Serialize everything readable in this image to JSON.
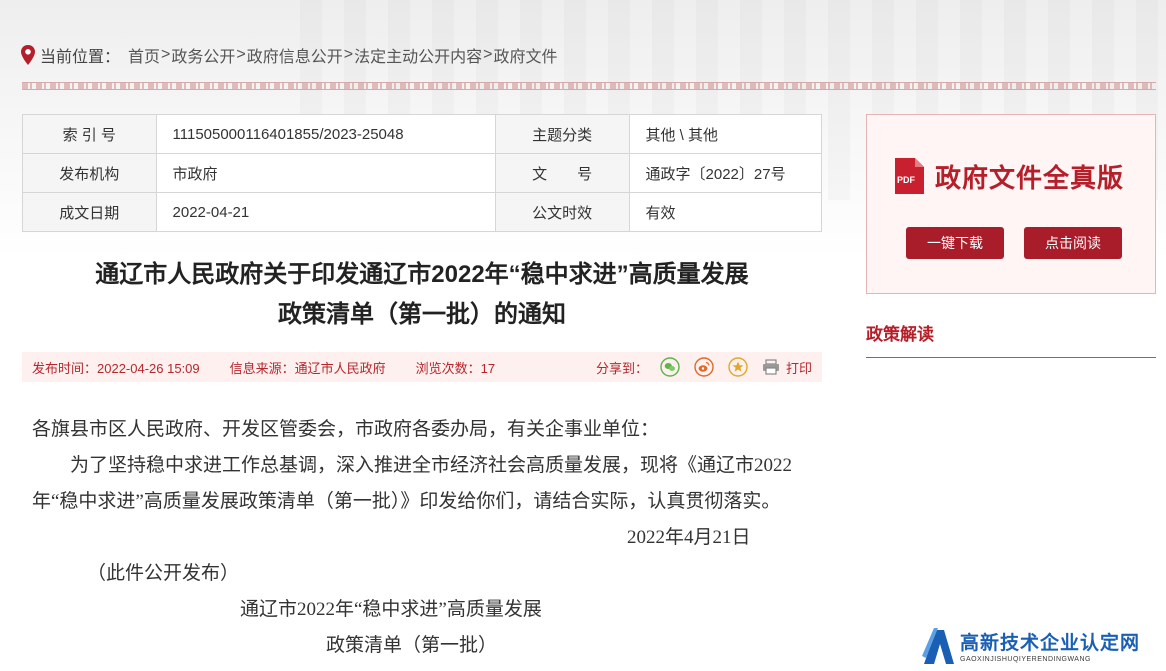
{
  "breadcrumb": {
    "label": "当前位置：",
    "items": [
      "首页",
      "政务公开",
      "政府信息公开",
      "法定主动公开内容",
      "政府文件"
    ],
    "separator": ">"
  },
  "meta": {
    "index_label": "索 引 号",
    "index_value": "111505000116401855/2023-25048",
    "topic_label": "主题分类",
    "topic_value": "其他 \\ 其他",
    "org_label": "发布机构",
    "org_value": "市政府",
    "docno_label": "文　　号",
    "docno_value": "通政字〔2022〕27号",
    "date_label": "成文日期",
    "date_value": "2022-04-21",
    "validity_label": "公文时效",
    "validity_value": "有效"
  },
  "title": {
    "line1": "通辽市人民政府关于印发通辽市2022年“稳中求进”高质量发展",
    "line2": "政策清单（第一批）的通知"
  },
  "infobar": {
    "publish_time": "发布时间：2022-04-26 15:09",
    "source": "信息来源：通辽市人民政府",
    "views": "浏览次数：17",
    "share_label": "分享到：",
    "print_label": "打印"
  },
  "content": {
    "salutation": "各旗县市区人民政府、开发区管委会，市政府各委办局，有关企事业单位：",
    "body": "为了坚持稳中求进工作总基调，深入推进全市经济社会高质量发展，现将《通辽市2022年“稳中求进”高质量发展政策清单（第一批）》印发给你们，请结合实际，认真贯彻落实。",
    "date": "2022年4月21日",
    "note": "（此件公开发布）",
    "subtitle1": "通辽市2022年“稳中求进”高质量发展",
    "subtitle2": "政策清单（第一批）"
  },
  "sidebar": {
    "box_title": "政府文件全真版",
    "download_label": "一键下载",
    "read_label": "点击阅读",
    "policy_read_label": "政策解读",
    "pdf_text": "PDF"
  },
  "watermark": {
    "main": "高新技术企业认定网",
    "sub": "GAOXINJISHUQIYERENDINGWANG"
  },
  "colors": {
    "accent": "#b51f2a",
    "button": "#a91d2a",
    "infobar_bg": "#fdf0ef",
    "watermark_blue": "#1a5fb4"
  }
}
